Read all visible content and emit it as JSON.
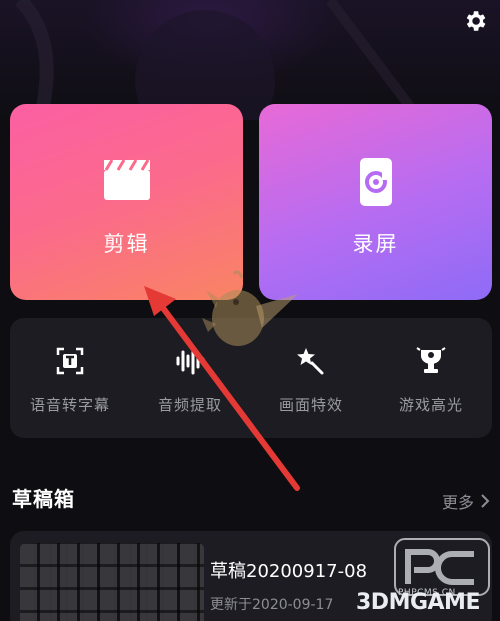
{
  "cards": {
    "edit": {
      "label": "剪辑",
      "icon": "clapperboard-icon"
    },
    "record": {
      "label": "录屏",
      "icon": "screen-record-icon"
    }
  },
  "tools": [
    {
      "label": "语音转字幕",
      "icon": "text-recognize-icon"
    },
    {
      "label": "音频提取",
      "icon": "audio-wave-icon"
    },
    {
      "label": "画面特效",
      "icon": "magic-star-icon"
    },
    {
      "label": "游戏高光",
      "icon": "trophy-icon"
    }
  ],
  "drafts": {
    "title": "草稿箱",
    "more_label": "更多",
    "items": [
      {
        "name": "草稿20200917-08",
        "updated": "更新于2020-09-17"
      }
    ]
  },
  "watermark": {
    "brand": "3DMGAME",
    "site": "PHPCMS.CN"
  },
  "colors": {
    "annotation_arrow": "#e53935",
    "edit_card": "#fb6b8a",
    "record_card": "#b56cf2"
  }
}
